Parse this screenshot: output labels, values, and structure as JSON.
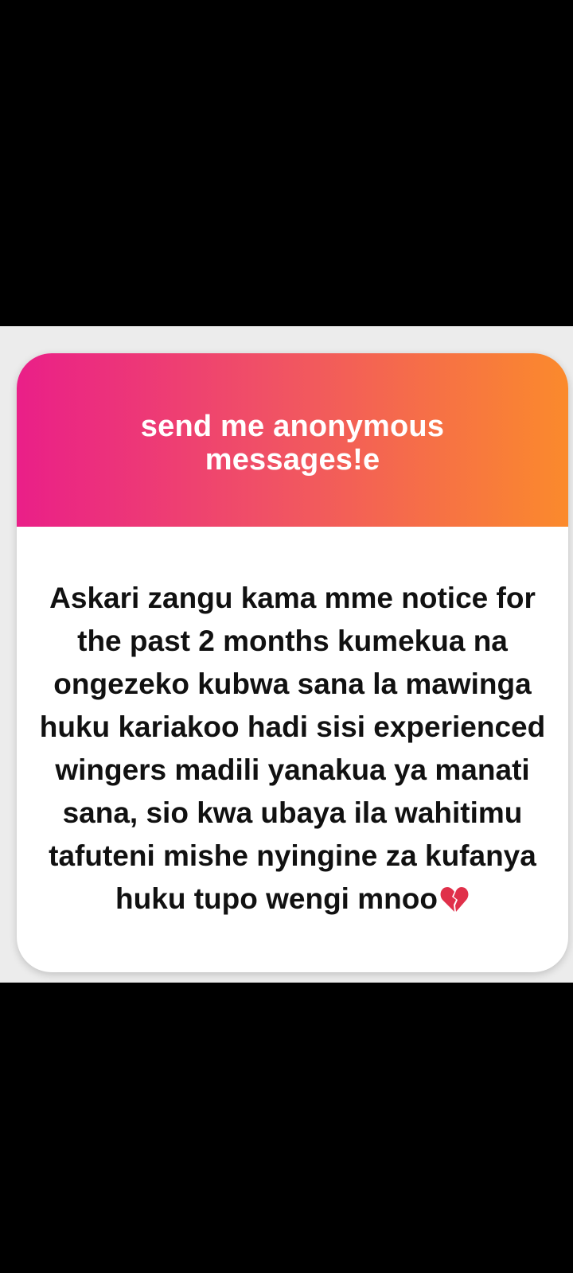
{
  "card": {
    "title": "send me anonymous messages!e",
    "message": "Askari zangu kama mme notice for the past 2 months kumekua na ongezeko kubwa sana la mawinga huku kariakoo hadi sisi experienced wingers madili yanakua ya manati sana, sio kwa ubaya ila wahitimu tafuteni mishe nyingine za kufanya huku tupo wengi mnoo",
    "message_trailing_icon": "broken-heart-icon"
  },
  "colors": {
    "background": "#000000",
    "panel": "#ececec",
    "card": "#ffffff",
    "gradient_start": "#ea1f88",
    "gradient_mid": "#f05066",
    "gradient_end": "#fb8a2c",
    "title_text": "#ffffff",
    "message_text": "#111111",
    "heart": "#e0304a"
  }
}
